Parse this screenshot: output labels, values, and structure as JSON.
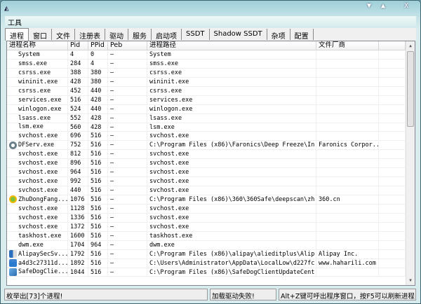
{
  "window": {
    "controls": [
      "▼",
      "▲",
      "X"
    ]
  },
  "menu": {
    "tools": "工具"
  },
  "tabs": [
    "进程",
    "窗口",
    "文件",
    "注册表",
    "驱动",
    "服务",
    "启动项",
    "SSDT",
    "Shadow SSDT",
    "杂项",
    "配置"
  ],
  "columns": [
    "进程名称",
    "Pid",
    "PPid",
    "Peb",
    "进程路径",
    "文件厂商",
    ""
  ],
  "rows": [
    [
      "System",
      "4",
      "0",
      "–",
      "System",
      "",
      ""
    ],
    [
      "smss.exe",
      "284",
      "4",
      "–",
      "smss.exe",
      "",
      ""
    ],
    [
      "csrss.exe",
      "388",
      "380",
      "–",
      "csrss.exe",
      "",
      ""
    ],
    [
      "wininit.exe",
      "428",
      "380",
      "–",
      "wininit.exe",
      "",
      ""
    ],
    [
      "csrss.exe",
      "452",
      "440",
      "–",
      "csrss.exe",
      "",
      ""
    ],
    [
      "services.exe",
      "516",
      "428",
      "–",
      "services.exe",
      "",
      ""
    ],
    [
      "winlogon.exe",
      "524",
      "440",
      "–",
      "winlogon.exe",
      "",
      ""
    ],
    [
      "lsass.exe",
      "552",
      "428",
      "–",
      "lsass.exe",
      "",
      ""
    ],
    [
      "lsm.exe",
      "560",
      "428",
      "–",
      "lsm.exe",
      "",
      ""
    ],
    [
      "svchost.exe",
      "696",
      "516",
      "–",
      "svchost.exe",
      "",
      ""
    ],
    [
      "DFServ.exe",
      "752",
      "516",
      "–",
      "C:\\Program Files (x86)\\Faronics\\Deep Freeze\\In...",
      "Faronics Corpor...",
      "",
      "deepfreeze"
    ],
    [
      "svchost.exe",
      "812",
      "516",
      "–",
      "svchost.exe",
      "",
      ""
    ],
    [
      "svchost.exe",
      "896",
      "516",
      "–",
      "svchost.exe",
      "",
      ""
    ],
    [
      "svchost.exe",
      "964",
      "516",
      "–",
      "svchost.exe",
      "",
      ""
    ],
    [
      "svchost.exe",
      "992",
      "516",
      "–",
      "svchost.exe",
      "",
      ""
    ],
    [
      "svchost.exe",
      "440",
      "516",
      "–",
      "svchost.exe",
      "",
      ""
    ],
    [
      "ZhuDongFang...",
      "1076",
      "516",
      "–",
      "C:\\Program Files (x86)\\360\\360Safe\\deepscan\\zh...",
      "360.cn",
      "",
      "360"
    ],
    [
      "svchost.exe",
      "1128",
      "516",
      "–",
      "svchost.exe",
      "",
      ""
    ],
    [
      "svchost.exe",
      "1336",
      "516",
      "–",
      "svchost.exe",
      "",
      ""
    ],
    [
      "svchost.exe",
      "1372",
      "516",
      "–",
      "svchost.exe",
      "",
      ""
    ],
    [
      "taskhost.exe",
      "1600",
      "516",
      "–",
      "taskhost.exe",
      "",
      ""
    ],
    [
      "dwm.exe",
      "1704",
      "964",
      "–",
      "dwm.exe",
      "",
      ""
    ],
    [
      "AlipaySecSv...",
      "1792",
      "516",
      "–",
      "C:\\Program Files (x86)\\alipay\\alieditplus\\Alip...",
      "Alipay Inc.",
      "",
      "alipay"
    ],
    [
      "a4d3c27311d...",
      "1892",
      "516",
      "–",
      "C:\\Users\\Administrator\\AppData\\LocalLow\\d227fc...",
      "www.haharili.com",
      "",
      "calendar"
    ],
    [
      "SafeDogClie...",
      "1044",
      "516",
      "–",
      "C:\\Program Files (x86)\\SafeDogClientUpdateCent...",
      "",
      "",
      "safedog"
    ]
  ],
  "status": {
    "count": "枚举出[73]个进程!",
    "driver": "加载驱动失败!",
    "hint": "Alt+Z键可呼出程序窗口，按F5可以刷新进程"
  }
}
